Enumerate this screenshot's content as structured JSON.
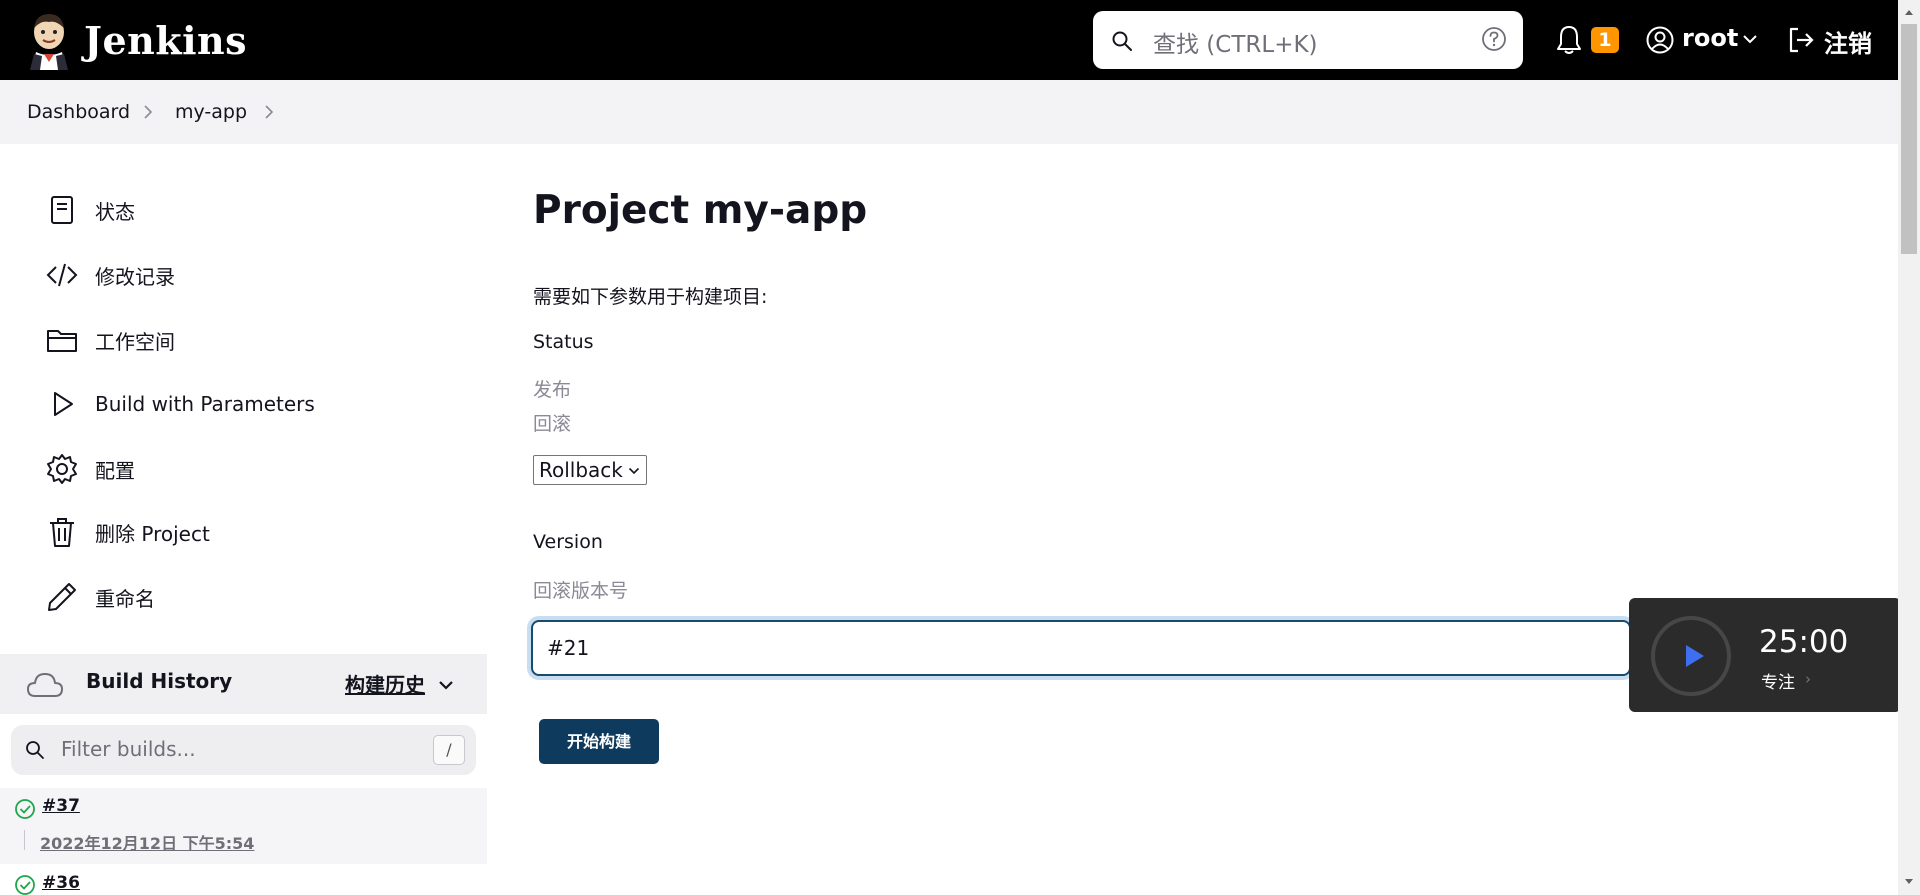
{
  "header": {
    "brand": "Jenkins",
    "search_placeholder": "查找 (CTRL+K)",
    "notification_count": "1",
    "user_name": "root",
    "logout_label": "注销"
  },
  "breadcrumb": [
    "Dashboard",
    "my-app"
  ],
  "sidebar": {
    "items": [
      {
        "label": "状态",
        "icon": "document-icon"
      },
      {
        "label": "修改记录",
        "icon": "code-icon"
      },
      {
        "label": "工作空间",
        "icon": "folder-icon"
      },
      {
        "label": "Build with Parameters",
        "icon": "play-icon"
      },
      {
        "label": "配置",
        "icon": "gear-icon"
      },
      {
        "label": "删除 Project",
        "icon": "trash-icon"
      },
      {
        "label": "重命名",
        "icon": "pencil-icon"
      }
    ],
    "build_history": {
      "title": "Build History",
      "link_label": "构建历史",
      "filter_placeholder": "Filter builds...",
      "filter_shortcut": "/"
    },
    "builds": [
      {
        "number": "#37",
        "date": "2022年12月12日 下午5:54",
        "status": "success"
      },
      {
        "number": "#36",
        "date": "",
        "status": "success"
      }
    ]
  },
  "main": {
    "title": "Project my-app",
    "intro": "需要如下参数用于构建项目:",
    "params": {
      "status": {
        "label": "Status",
        "desc_lines": [
          "发布",
          "回滚"
        ],
        "selected": "Rollback"
      },
      "version": {
        "label": "Version",
        "desc": "回滚版本号",
        "value": "#21"
      }
    },
    "build_button": "开始构建"
  },
  "focus_widget": {
    "time": "25:00",
    "mode_label": "专注"
  },
  "colors": {
    "header_bg": "#000000",
    "badge": "#ff9500",
    "primary_button": "#0e3a5e",
    "success": "#1ea64b"
  }
}
